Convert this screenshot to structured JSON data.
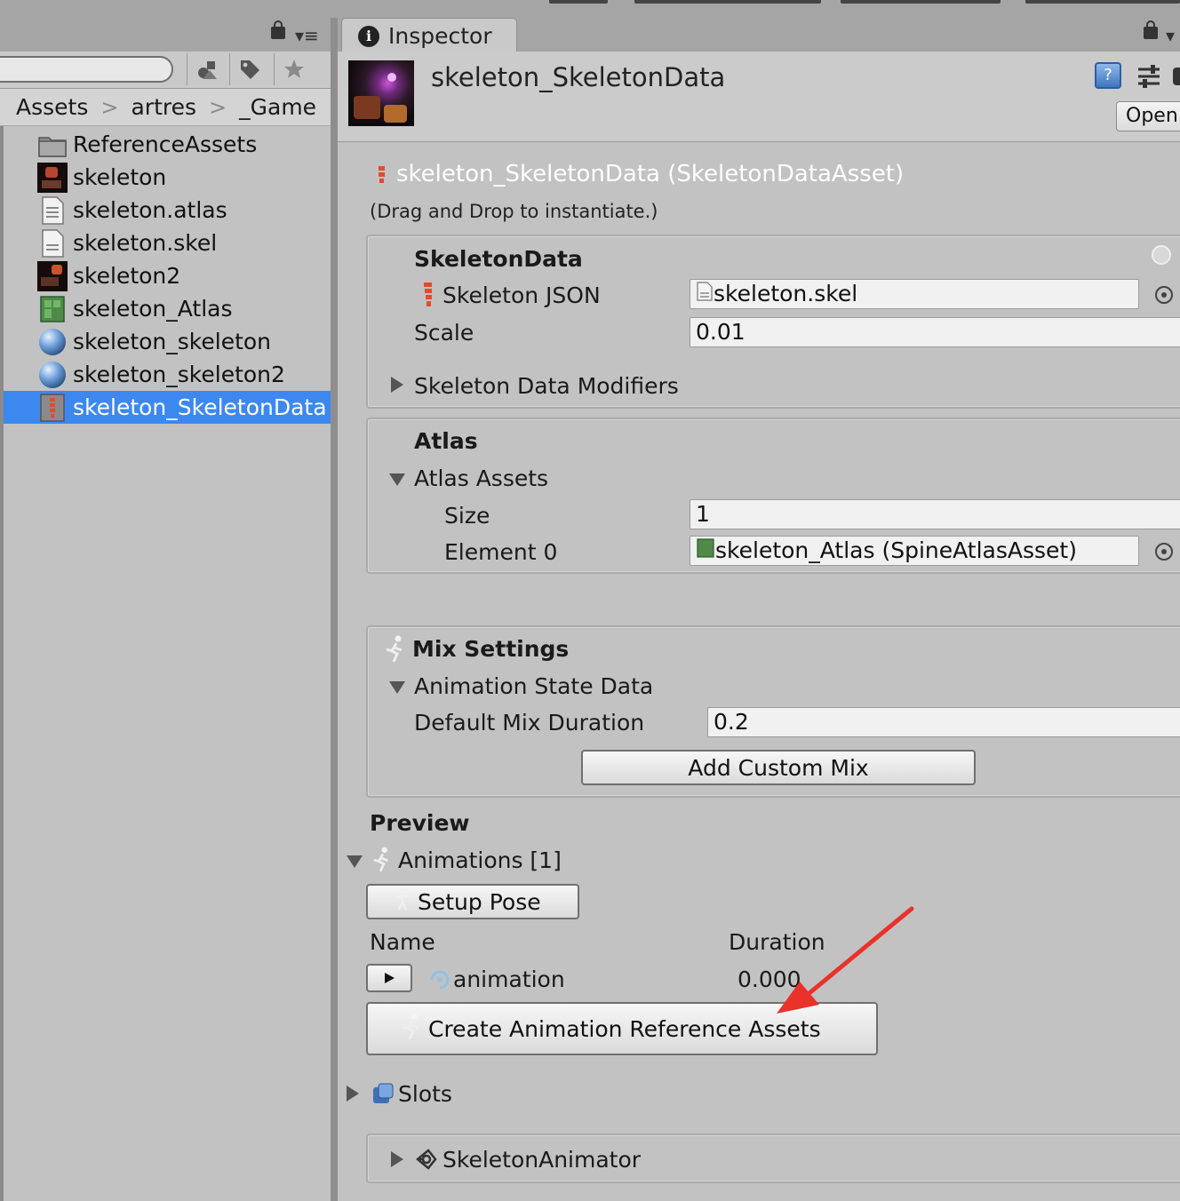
{
  "project": {
    "breadcrumb": [
      "Assets",
      "artres",
      "_Game"
    ],
    "breadcrumb_separator": ">",
    "items": [
      {
        "label": "ReferenceAssets",
        "icon": "folder-icon"
      },
      {
        "label": "skeleton",
        "icon": "texture-icon"
      },
      {
        "label": "skeleton.atlas",
        "icon": "text-file-icon"
      },
      {
        "label": "skeleton.skel",
        "icon": "text-file-icon"
      },
      {
        "label": "skeleton2",
        "icon": "texture-icon"
      },
      {
        "label": "skeleton_Atlas",
        "icon": "atlas-asset-icon"
      },
      {
        "label": "skeleton_skeleton",
        "icon": "material-sphere-icon"
      },
      {
        "label": "skeleton_skeleton2",
        "icon": "material-sphere-icon"
      },
      {
        "label": "skeleton_SkeletonData",
        "icon": "skeleton-data-icon",
        "selected": true
      }
    ]
  },
  "inspector": {
    "tab_label": "Inspector",
    "asset_name": "skeleton_SkeletonData",
    "open_label": "Open",
    "section_title": "skeleton_SkeletonData (SkeletonDataAsset)",
    "drag_hint": "(Drag and Drop to instantiate.)",
    "skeleton_data": {
      "header": "SkeletonData",
      "json_label": "Skeleton JSON",
      "json_value": "skeleton.skel",
      "scale_label": "Scale",
      "scale_value": "0.01",
      "modifiers_label": "Skeleton Data Modifiers"
    },
    "atlas": {
      "header": "Atlas",
      "assets_label": "Atlas Assets",
      "size_label": "Size",
      "size_value": "1",
      "element_label": "Element 0",
      "element_value": "skeleton_Atlas (SpineAtlasAsset)"
    },
    "mix": {
      "header": "Mix Settings",
      "state_label": "Animation State Data",
      "duration_label": "Default Mix Duration",
      "duration_value": "0.2",
      "add_button": "Add Custom Mix"
    },
    "preview": {
      "header": "Preview",
      "animations_label": "Animations [1]",
      "setup_pose": "Setup Pose",
      "name_col": "Name",
      "duration_col": "Duration",
      "animation_name": "animation",
      "animation_duration": "0.000",
      "create_refs_button": "Create Animation Reference Assets"
    },
    "slots_label": "Slots",
    "animator_label": "SkeletonAnimator"
  },
  "colors": {
    "selection": "#3c88f0",
    "arrow": "#e8322a"
  }
}
